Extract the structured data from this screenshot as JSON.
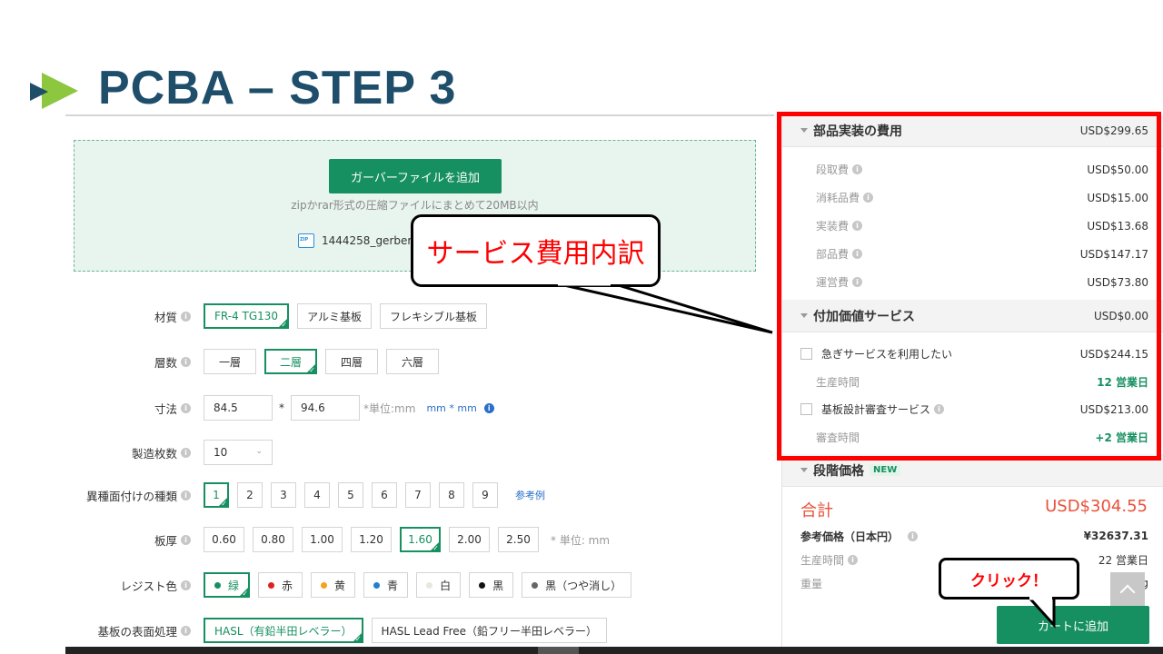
{
  "slide": {
    "title": "PCBA – STEP 3"
  },
  "upload": {
    "button_label": "ガーバーファイルを追加",
    "hint": "zipかrar形式の圧縮ファイルにまとめて20MB以内",
    "file_name": "1444258_gerberf"
  },
  "form": {
    "material": {
      "label": "材質",
      "options": [
        "FR-4 TG130",
        "アルミ基板",
        "フレキシブル基板"
      ],
      "selected": "FR-4 TG130"
    },
    "layers": {
      "label": "層数",
      "options": [
        "一層",
        "二層",
        "四層",
        "六層"
      ],
      "selected": "二層"
    },
    "size": {
      "label": "寸法",
      "width": "84.5",
      "separator": "*",
      "height": "94.6",
      "unit_text": "*単位:mm",
      "unit_link": "mm * mm"
    },
    "quantity": {
      "label": "製造枚数",
      "value": "10"
    },
    "kinds": {
      "label": "異種面付けの種類",
      "options": [
        "1",
        "2",
        "3",
        "4",
        "5",
        "6",
        "7",
        "8",
        "9"
      ],
      "selected": "1",
      "example_link": "参考例"
    },
    "thickness": {
      "label": "板厚",
      "options": [
        "0.60",
        "0.80",
        "1.00",
        "1.20",
        "1.60",
        "2.00",
        "2.50"
      ],
      "selected": "1.60",
      "unit": "* 単位: mm"
    },
    "resist": {
      "label": "レジスト色",
      "options": [
        {
          "label": "緑",
          "color": "#169060"
        },
        {
          "label": "赤",
          "color": "#e02020"
        },
        {
          "label": "黄",
          "color": "#f2a31b"
        },
        {
          "label": "青",
          "color": "#1f7fd0"
        },
        {
          "label": "白",
          "color": "#e8e8e0"
        },
        {
          "label": "黒",
          "color": "#111111"
        },
        {
          "label": "黒（つや消し）",
          "color": "#666666"
        }
      ],
      "selected": "緑"
    },
    "finish": {
      "label": "基板の表面処理",
      "options": [
        "HASL（有鉛半田レベラー）",
        "HASL Lead Free（鉛フリー半田レベラー）"
      ],
      "selected": "HASL（有鉛半田レベラー）"
    }
  },
  "panel": {
    "assembly": {
      "title": "部品実装の費用",
      "amount": "USD$299.65",
      "items": [
        {
          "label": "段取費",
          "value": "USD$50.00"
        },
        {
          "label": "消耗品費",
          "value": "USD$15.00"
        },
        {
          "label": "実装費",
          "value": "USD$13.68"
        },
        {
          "label": "部品費",
          "value": "USD$147.17"
        },
        {
          "label": "運営費",
          "value": "USD$73.80"
        }
      ]
    },
    "value_added": {
      "title": "付加価値サービス",
      "amount": "USD$0.00",
      "express": {
        "label": "急ぎサービスを利用したい",
        "value": "USD$244.15"
      },
      "production_time": {
        "label": "生産時間",
        "value": "12 営業日"
      },
      "design_review": {
        "label": "基板設計審査サービス",
        "value": "USD$213.00"
      },
      "review_time": {
        "label": "審査時間",
        "value": "+2 営業日"
      }
    },
    "tier": {
      "title": "段階価格",
      "badge": "NEW"
    },
    "total": {
      "label": "合計",
      "amount": "USD$304.55"
    },
    "reference": {
      "label": "参考価格（日本円）",
      "value": "¥32637.31"
    },
    "lead_time": {
      "label": "生産時間",
      "value": "22 営業日"
    },
    "weight": {
      "label": "重量",
      "value": "g"
    },
    "cart_button": "カートに追加"
  },
  "callouts": {
    "service_breakdown": "サービス費用内訳",
    "click": "クリック！"
  },
  "colors": {
    "accent": "#169060",
    "title": "#1f4e6b",
    "highlight": "#ff0000",
    "total": "#e8523a"
  }
}
